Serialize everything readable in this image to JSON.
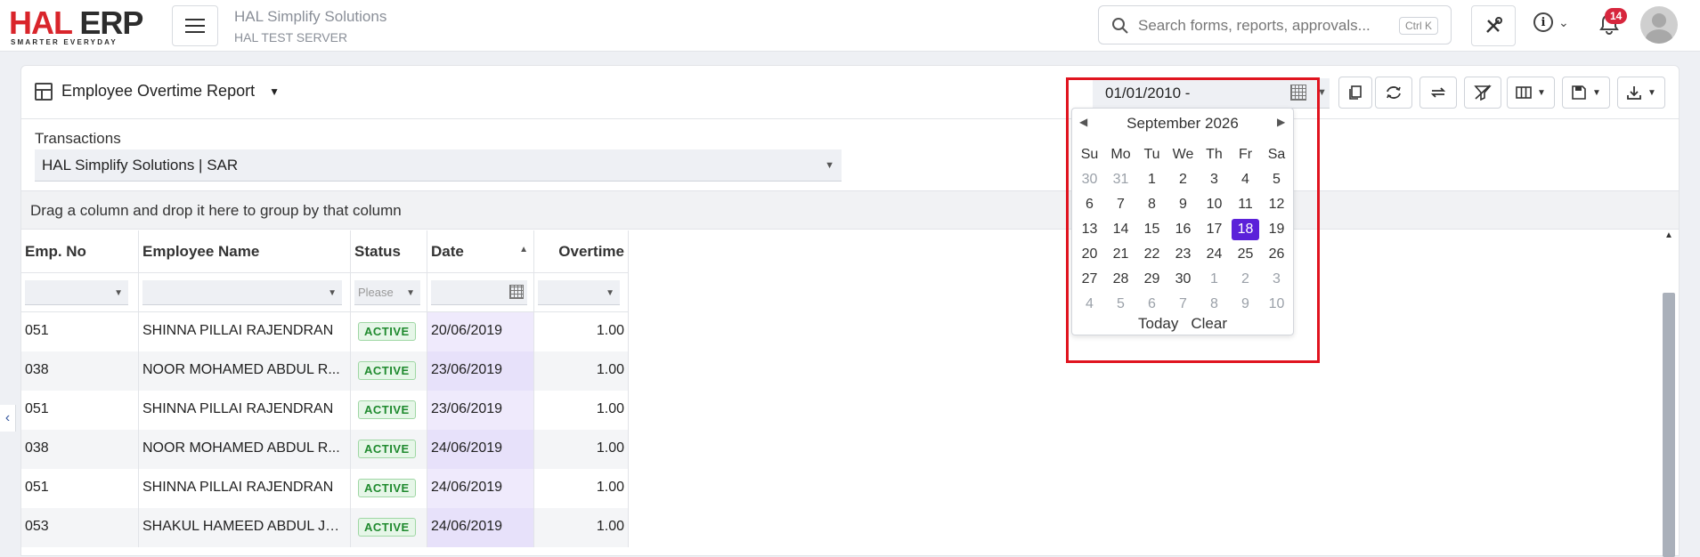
{
  "brand": {
    "logo_hal": "HAL",
    "logo_erp": "ERP",
    "tagline": "SMARTER EVERYDAY"
  },
  "company": {
    "name": "HAL Simplify Solutions",
    "server": "HAL TEST SERVER"
  },
  "search": {
    "placeholder": "Search forms, reports, approvals...",
    "shortcut": "Ctrl K"
  },
  "notifications": {
    "count": "14"
  },
  "report": {
    "title": "Employee Overtime Report"
  },
  "date_filter": {
    "value": "01/01/2010 -",
    "month_label": "September 2026",
    "weekdays": [
      "Su",
      "Mo",
      "Tu",
      "We",
      "Th",
      "Fr",
      "Sa"
    ],
    "weeks": [
      [
        "30",
        "31",
        "1",
        "2",
        "3",
        "4",
        "5"
      ],
      [
        "6",
        "7",
        "8",
        "9",
        "10",
        "11",
        "12"
      ],
      [
        "13",
        "14",
        "15",
        "16",
        "17",
        "18",
        "19"
      ],
      [
        "20",
        "21",
        "22",
        "23",
        "24",
        "25",
        "26"
      ],
      [
        "27",
        "28",
        "29",
        "30",
        "1",
        "2",
        "3"
      ],
      [
        "4",
        "5",
        "6",
        "7",
        "8",
        "9",
        "10"
      ]
    ],
    "selected_day": "18",
    "today_label": "Today",
    "clear_label": "Clear"
  },
  "filters": {
    "transactions_label": "Transactions",
    "transactions_value": "HAL Simplify Solutions | SAR"
  },
  "group_bar": {
    "text": "Drag a column and drop it here to group by that column"
  },
  "table": {
    "columns": [
      "Emp. No",
      "Employee Name",
      "Status",
      "Date",
      "Overtime"
    ],
    "status_filter_placeholder": "Please",
    "rows": [
      {
        "emp_no": "051",
        "name": "SHINNA PILLAI RAJENDRAN",
        "status": "ACTIVE",
        "date": "20/06/2019",
        "overtime": "1.00"
      },
      {
        "emp_no": "038",
        "name": "NOOR MOHAMED ABDUL R...",
        "status": "ACTIVE",
        "date": "23/06/2019",
        "overtime": "1.00"
      },
      {
        "emp_no": "051",
        "name": "SHINNA PILLAI RAJENDRAN",
        "status": "ACTIVE",
        "date": "23/06/2019",
        "overtime": "1.00"
      },
      {
        "emp_no": "038",
        "name": "NOOR MOHAMED ABDUL R...",
        "status": "ACTIVE",
        "date": "24/06/2019",
        "overtime": "1.00"
      },
      {
        "emp_no": "051",
        "name": "SHINNA PILLAI RAJENDRAN",
        "status": "ACTIVE",
        "date": "24/06/2019",
        "overtime": "1.00"
      },
      {
        "emp_no": "053",
        "name": "SHAKUL HAMEED ABDUL JA...",
        "status": "ACTIVE",
        "date": "24/06/2019",
        "overtime": "1.00"
      }
    ]
  },
  "colors": {
    "brand_red": "#d9252b",
    "selected_day": "#5b21d9",
    "status_green": "#1f8a2e",
    "highlight_red": "#e0141f"
  },
  "icons": [
    "menu-icon",
    "search-icon",
    "tools-icon",
    "info-icon",
    "bell-icon",
    "grid-icon",
    "calendar-icon",
    "copy-icon",
    "refresh-icon",
    "swap-icon",
    "clear-filter-icon",
    "columns-icon",
    "save-icon",
    "download-icon"
  ]
}
